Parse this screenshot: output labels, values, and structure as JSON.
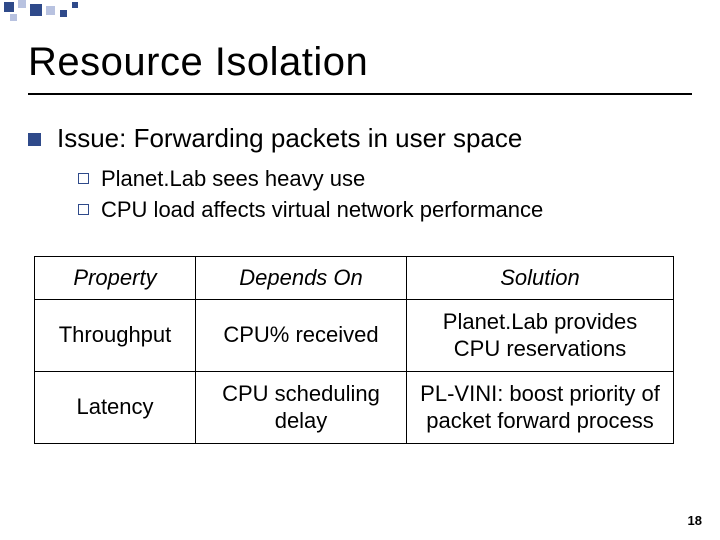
{
  "title": "Resource Isolation",
  "issue": "Issue: Forwarding packets in user space",
  "sub": [
    "Planet.Lab sees heavy use",
    "CPU load affects virtual network performance"
  ],
  "table": {
    "headers": [
      "Property",
      "Depends On",
      "Solution"
    ],
    "rows": [
      {
        "property": "Throughput",
        "depends": "CPU% received",
        "solution": "Planet.Lab provides CPU reservations"
      },
      {
        "property": "Latency",
        "depends": "CPU scheduling delay",
        "solution": "PL-VINI: boost priority of packet forward process"
      }
    ]
  },
  "page_number": "18"
}
